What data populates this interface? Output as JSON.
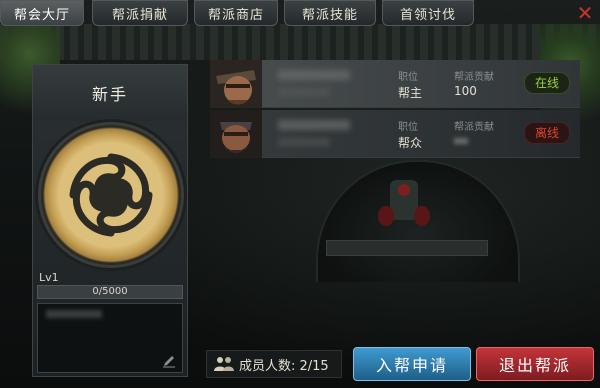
{
  "tabs": [
    {
      "label": "帮会大厅",
      "active": true
    },
    {
      "label": "帮派捐献",
      "active": false
    },
    {
      "label": "帮派商店",
      "active": false
    },
    {
      "label": "帮派技能",
      "active": false
    },
    {
      "label": "首领讨伐",
      "active": false
    }
  ],
  "guild": {
    "rank_title": "新手",
    "level": "Lv1",
    "exp_text": "0/5000",
    "exp_fraction": 0.0
  },
  "columns": {
    "position_label": "职位",
    "contribution_label": "帮派贡献"
  },
  "members": [
    {
      "position": "帮主",
      "contribution": "100",
      "status": "在线"
    },
    {
      "position": "帮众",
      "contribution": "",
      "status": "离线"
    }
  ],
  "footer": {
    "members_count": "成员人数: 2/15",
    "join_label": "入帮申请",
    "leave_label": "退出帮派"
  },
  "colors": {
    "online": "#9ad33a",
    "offline": "#e0442c",
    "join_button": "#2f7cb0",
    "leave_button": "#b02a30",
    "emblem_gold": "#dcbf7a"
  },
  "icons": [
    "close-icon",
    "guild-emblem-icon",
    "edit-icon",
    "people-icon"
  ]
}
